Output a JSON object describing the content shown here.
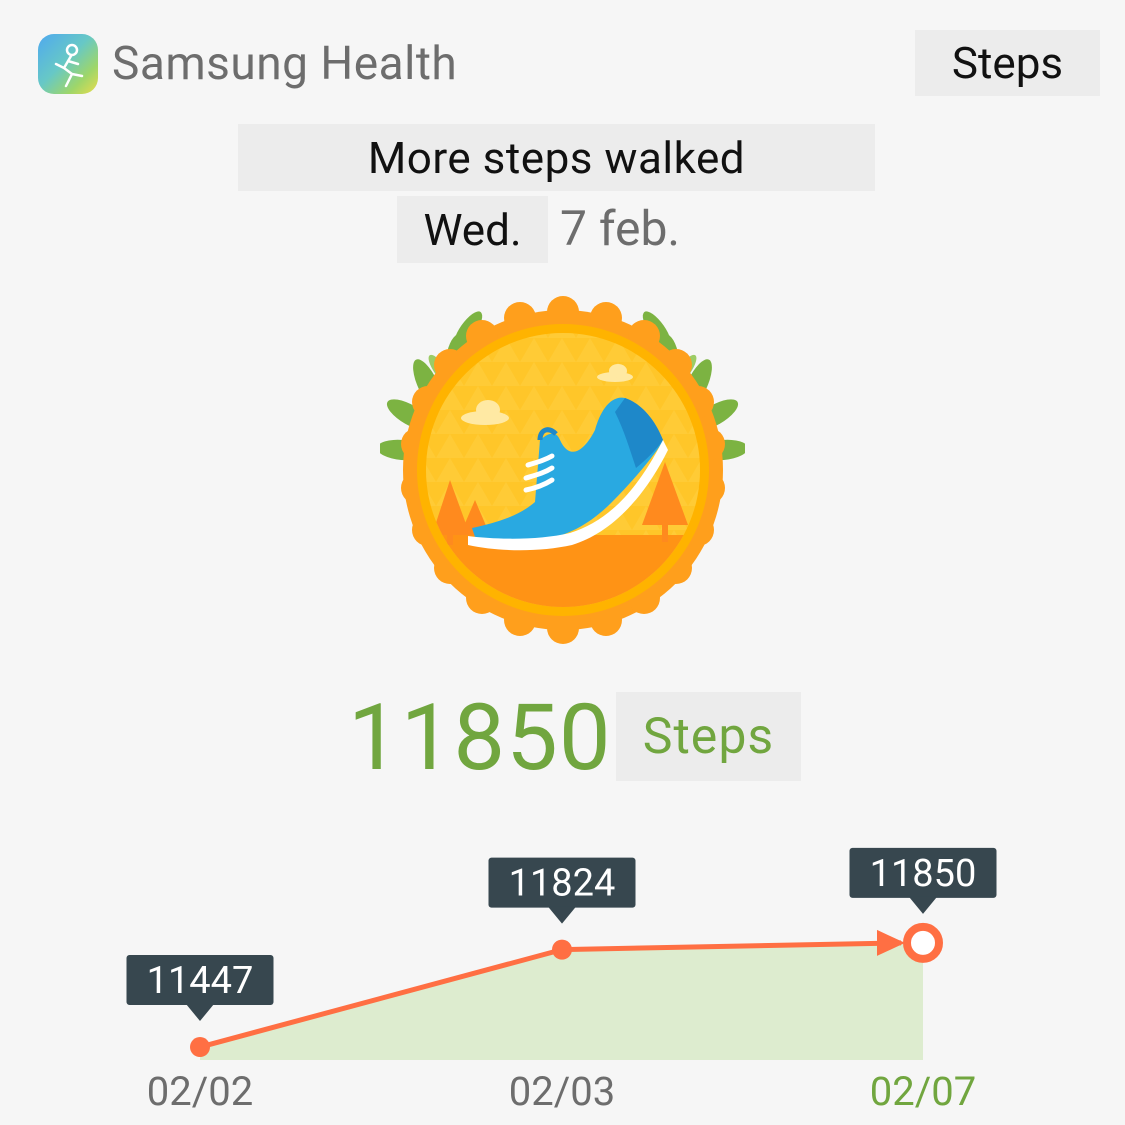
{
  "header": {
    "app_name": "Samsung Health",
    "app_icon": "samsung-health-icon",
    "section_label": "Steps"
  },
  "achievement": {
    "title": "More steps walked",
    "day": "Wed.",
    "date": "7 feb.",
    "badge_icon": "running-shoe-medal-icon"
  },
  "record": {
    "value": "11850",
    "unit": "Steps"
  },
  "colors": {
    "accent_green": "#71a63f",
    "line_orange": "#ff6f43",
    "area_green": "#ddeccf",
    "tooltip_dark": "#37474f"
  },
  "chart_data": {
    "type": "line",
    "categories": [
      "02/02",
      "02/03",
      "02/07"
    ],
    "values": [
      11447,
      11824,
      11850
    ],
    "highlight_index": 2
  }
}
